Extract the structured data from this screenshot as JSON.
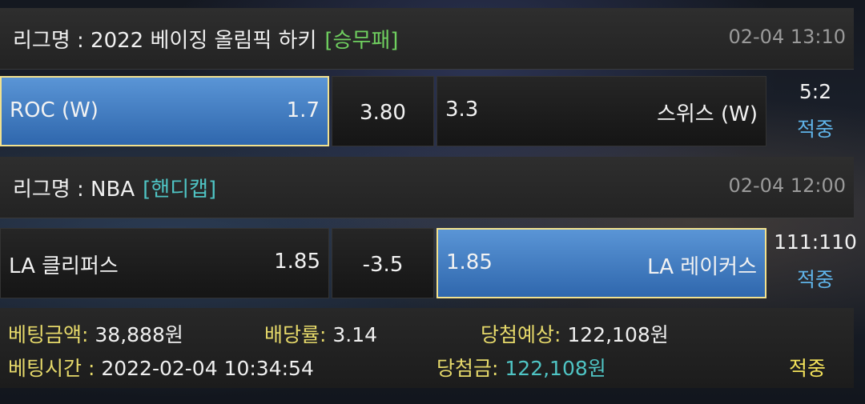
{
  "matches": [
    {
      "league_label": "리그명 : 2022 베이징 올림픽 하키",
      "bet_type": "[승무패]",
      "bet_type_color": "#6fcf5f",
      "time": "02-04 13:10",
      "home": {
        "name": "ROC (W)",
        "odds": "1.7"
      },
      "middle": "3.80",
      "away": {
        "name": "스위스 (W)",
        "odds": "3.3"
      },
      "selected": "home",
      "score": "5:2",
      "status": "적중"
    },
    {
      "league_label": "리그명 : NBA",
      "bet_type": "[핸디캡]",
      "bet_type_color": "#4fc4c4",
      "time": "02-04 12:00",
      "home": {
        "name": "LA 클리퍼스",
        "odds": "1.85"
      },
      "middle": "-3.5",
      "away": {
        "name": "LA 레이커스",
        "odds": "1.85"
      },
      "selected": "away",
      "score": "111:110",
      "status": "적중"
    }
  ],
  "summary": {
    "bet_amount_label": "베팅금액:",
    "bet_amount": "38,888원",
    "odds_label": "배당률:",
    "odds": "3.14",
    "expected_label": "당첨예상:",
    "expected": "122,108원",
    "bet_time_label": "베팅시간 :",
    "bet_time": "2022-02-04 10:34:54",
    "win_label": "당첨금:",
    "win_amount": "122,108원",
    "result": "적중"
  },
  "colors": {
    "accent_blue": "#3a7bc8",
    "label_yellow": "#e6d96a",
    "teal": "#4fc4c4",
    "status_blue": "#5fb3e8"
  }
}
